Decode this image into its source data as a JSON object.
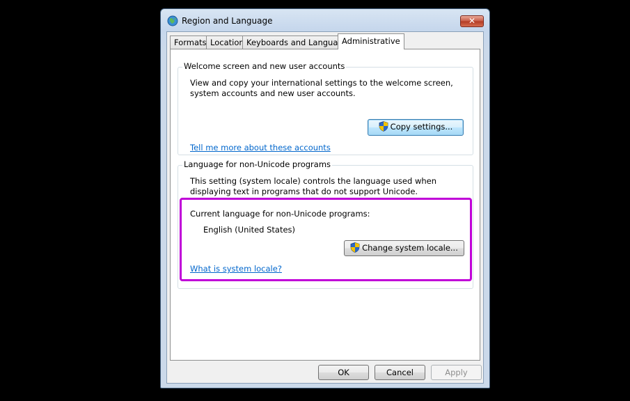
{
  "window": {
    "title": "Region and Language",
    "close_label": "✕"
  },
  "tabs": [
    {
      "label": "Formats"
    },
    {
      "label": "Location"
    },
    {
      "label": "Keyboards and Languages"
    },
    {
      "label": "Administrative"
    }
  ],
  "welcome": {
    "title": "Welcome screen and new user accounts",
    "description": "View and copy your international settings to the welcome screen, system accounts and new user accounts.",
    "copy_button": "Copy settings...",
    "link": "Tell me more about these accounts"
  },
  "non_unicode": {
    "title": "Language for non-Unicode programs",
    "description": "This setting (system locale) controls the language used when displaying text in programs that do not support Unicode.",
    "current_label": "Current language for non-Unicode programs:",
    "current_value": "English (United States)",
    "change_button": "Change system locale...",
    "link": "What is system locale?"
  },
  "footer": {
    "ok": "OK",
    "cancel": "Cancel",
    "apply": "Apply"
  },
  "colors": {
    "highlight": "#c000d8",
    "link": "#0066cc"
  }
}
